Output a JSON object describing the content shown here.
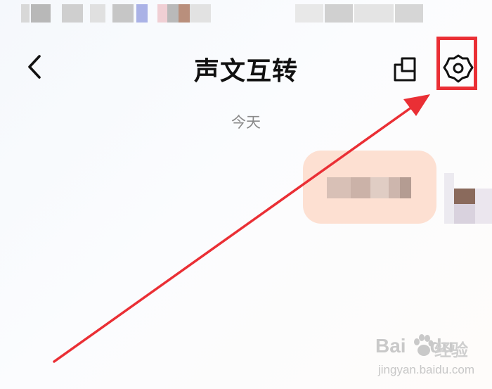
{
  "nav": {
    "back_icon": "chevron-left-icon",
    "title": "声文互转",
    "square_icon": "copy-square-icon",
    "settings_icon": "gear-icon"
  },
  "chat": {
    "date_separator": "今天"
  },
  "annotation": {
    "color": "#ea2f35"
  },
  "watermark": {
    "main": "Bai",
    "du_suffix": "du",
    "cn": "经验",
    "url": "jingyan.baidu.com"
  }
}
